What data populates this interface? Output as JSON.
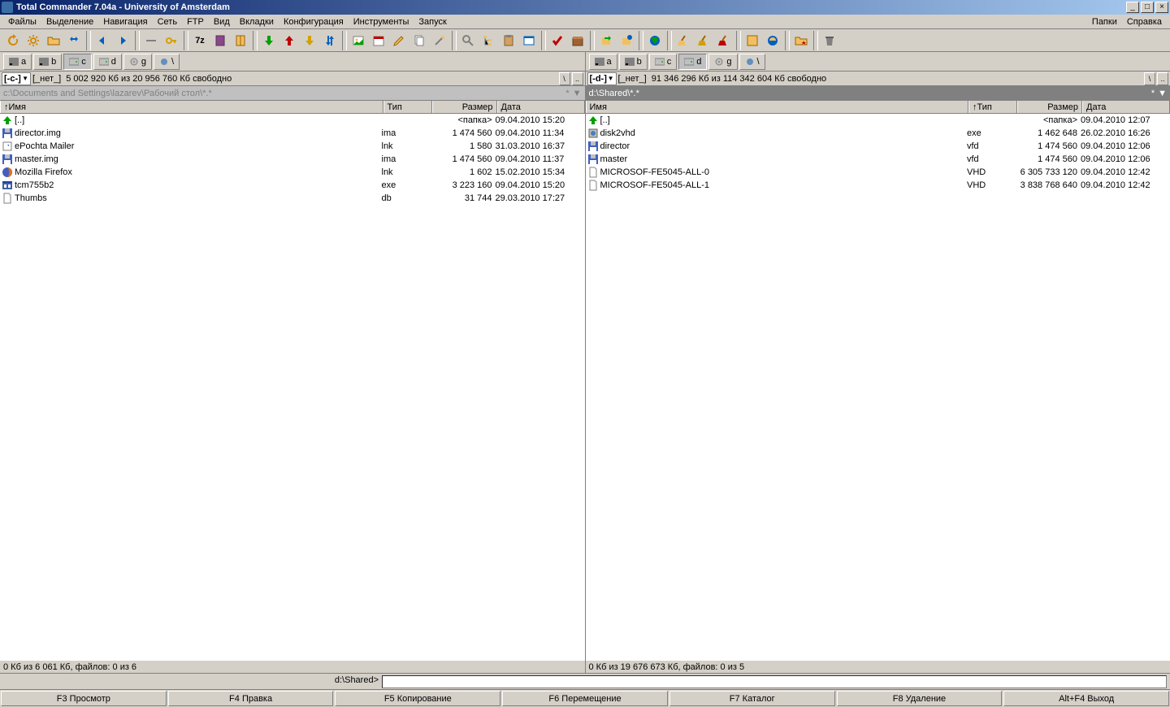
{
  "title": "Total Commander 7.04a - University of Amsterdam",
  "menus": [
    "Файлы",
    "Выделение",
    "Навигация",
    "Сеть",
    "FTP",
    "Вид",
    "Вкладки",
    "Конфигурация",
    "Инструменты",
    "Запуск"
  ],
  "menus_right": [
    "Папки",
    "Справка"
  ],
  "drives": [
    "a",
    "b",
    "c",
    "d",
    "g"
  ],
  "left": {
    "drive_sel": "[-c-]",
    "drive_label": "[_нет_]",
    "free_text": "5 002 920 Кб из 20 956 760 Кб свободно",
    "path": "c:\\Documents and Settings\\lazarev\\Рабочий стол\\*.*",
    "active_drive": "c",
    "cols": {
      "name": "↑Имя",
      "type": "Тип",
      "size": "Размер",
      "date": "Дата"
    },
    "files": [
      {
        "icon": "up",
        "name": "[..]",
        "type": "",
        "size": "<папка>",
        "date": "09.04.2010 15:20"
      },
      {
        "icon": "disk",
        "name": "director.img",
        "type": "ima",
        "size": "1 474 560",
        "date": "09.04.2010 11:34"
      },
      {
        "icon": "link",
        "name": "ePochta Mailer",
        "type": "lnk",
        "size": "1 580",
        "date": "31.03.2010 16:37"
      },
      {
        "icon": "disk",
        "name": "master.img",
        "type": "ima",
        "size": "1 474 560",
        "date": "09.04.2010 11:37"
      },
      {
        "icon": "firefox",
        "name": "Mozilla Firefox",
        "type": "lnk",
        "size": "1 602",
        "date": "15.02.2010 15:34"
      },
      {
        "icon": "exe",
        "name": "tcm755b2",
        "type": "exe",
        "size": "3 223 160",
        "date": "09.04.2010 15:20"
      },
      {
        "icon": "file",
        "name": "Thumbs",
        "type": "db",
        "size": "31 744",
        "date": "29.03.2010 17:27"
      }
    ],
    "status": "0 Кб из 6 061 Кб, файлов: 0 из 6"
  },
  "right": {
    "drive_sel": "[-d-]",
    "drive_label": "[_нет_]",
    "free_text": "91 346 296 Кб из 114 342 604 Кб свободно",
    "path": "d:\\Shared\\*.*",
    "active_drive": "d",
    "cols": {
      "name": "Имя",
      "type": "↑Тип",
      "size": "Размер",
      "date": "Дата"
    },
    "files": [
      {
        "icon": "up",
        "name": "[..]",
        "type": "",
        "size": "<папка>",
        "date": "09.04.2010 12:07"
      },
      {
        "icon": "app",
        "name": "disk2vhd",
        "type": "exe",
        "size": "1 462 648",
        "date": "26.02.2010 16:26"
      },
      {
        "icon": "disk",
        "name": "director",
        "type": "vfd",
        "size": "1 474 560",
        "date": "09.04.2010 12:06"
      },
      {
        "icon": "disk",
        "name": "master",
        "type": "vfd",
        "size": "1 474 560",
        "date": "09.04.2010 12:06"
      },
      {
        "icon": "file",
        "name": "MICROSOF-FE5045-ALL-0",
        "type": "VHD",
        "size": "6 305 733 120",
        "date": "09.04.2010 12:42"
      },
      {
        "icon": "file",
        "name": "MICROSOF-FE5045-ALL-1",
        "type": "VHD",
        "size": "3 838 768 640",
        "date": "09.04.2010 12:42"
      }
    ],
    "status": "0 Кб из 19 676 673 Кб, файлов: 0 из 5"
  },
  "cmd_prompt": "d:\\Shared>",
  "cmd_value": "",
  "fn_buttons": [
    "F3 Просмотр",
    "F4 Правка",
    "F5 Копирование",
    "F6 Перемещение",
    "F7 Каталог",
    "F8 Удаление",
    "Alt+F4 Выход"
  ]
}
